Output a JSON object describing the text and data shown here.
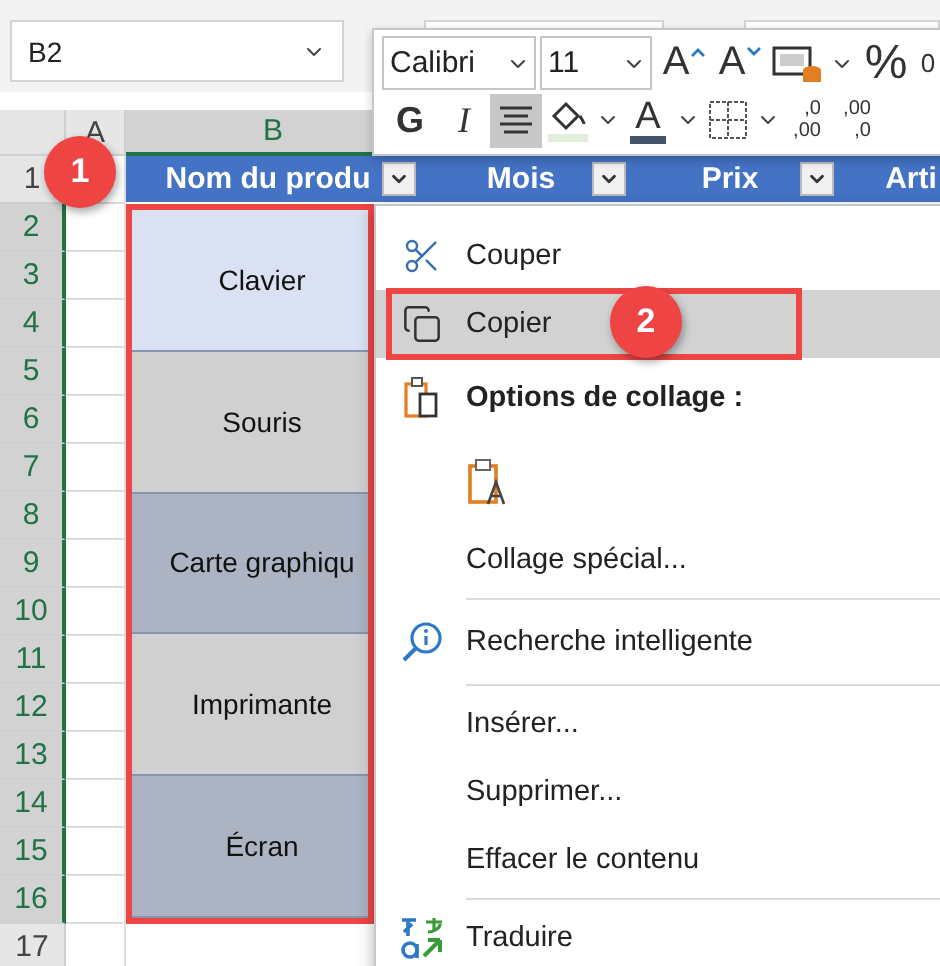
{
  "name_box": {
    "value": "B2"
  },
  "column_headers": [
    {
      "label": "A",
      "selected": false
    },
    {
      "label": "B",
      "selected": true
    }
  ],
  "row_headers": [
    {
      "label": "1",
      "selected": false
    },
    {
      "label": "2",
      "selected": true
    },
    {
      "label": "3",
      "selected": true
    },
    {
      "label": "4",
      "selected": true
    },
    {
      "label": "5",
      "selected": true
    },
    {
      "label": "6",
      "selected": true
    },
    {
      "label": "7",
      "selected": true
    },
    {
      "label": "8",
      "selected": true
    },
    {
      "label": "9",
      "selected": true
    },
    {
      "label": "10",
      "selected": true
    },
    {
      "label": "11",
      "selected": true
    },
    {
      "label": "12",
      "selected": true
    },
    {
      "label": "13",
      "selected": true
    },
    {
      "label": "14",
      "selected": true
    },
    {
      "label": "15",
      "selected": true
    },
    {
      "label": "16",
      "selected": true
    },
    {
      "label": "17",
      "selected": false
    }
  ],
  "table_header": [
    {
      "text": "Nom du produ",
      "filter": true
    },
    {
      "text": "Mois",
      "filter": true
    },
    {
      "text": "Prix",
      "filter": true
    },
    {
      "text": "Arti",
      "filter": false
    }
  ],
  "products": [
    {
      "text": "Clavier",
      "color": "#d9e1f2"
    },
    {
      "text": "Souris",
      "color": "#d0d0d0"
    },
    {
      "text": "Carte graphiqu",
      "color": "#acb4c4"
    },
    {
      "text": "Imprimante",
      "color": "#d0d0d0"
    },
    {
      "text": "Écran",
      "color": "#acb4c4"
    }
  ],
  "callouts": [
    "1",
    "2"
  ],
  "mini_toolbar": {
    "font": "Calibri",
    "size": "11",
    "row_1": [
      {
        "kind": "grow",
        "label": "A"
      },
      {
        "kind": "shrink",
        "label": "A"
      },
      {
        "kind": "format"
      },
      {
        "kind": "caret"
      },
      {
        "kind": "percent",
        "label": "%"
      },
      {
        "kind": "comma",
        "label": "0"
      }
    ],
    "row_2": [
      {
        "kind": "bold",
        "label": "G",
        "selected": false
      },
      {
        "kind": "italic",
        "label": "I",
        "selected": false
      },
      {
        "kind": "align",
        "selected": true
      },
      {
        "kind": "fill"
      },
      {
        "kind": "caret"
      },
      {
        "kind": "color",
        "label": "A"
      },
      {
        "kind": "caret"
      },
      {
        "kind": "borders"
      },
      {
        "kind": "caret"
      },
      {
        "kind": "decimal",
        "top": ",0",
        "bottom": ",00"
      },
      {
        "kind": "decimal",
        "top": ",00",
        "bottom": ",0"
      }
    ]
  },
  "context_menu": [
    {
      "kind": "cut",
      "label": "Couper",
      "selected": false,
      "annotated": false
    },
    {
      "kind": "copy",
      "label": "Copier",
      "selected": true,
      "annotated": true
    },
    {
      "kind": "heading",
      "label": "Options de collage :"
    },
    {
      "kind": "paste_options"
    },
    {
      "kind": "command",
      "label": "Collage spécial...",
      "selected": false,
      "annotated": false
    },
    {
      "kind": "separator"
    },
    {
      "kind": "lookup",
      "label": "Recherche intelligente",
      "selected": false,
      "annotated": false
    },
    {
      "kind": "separator"
    },
    {
      "kind": "command",
      "label": "Insérer...",
      "selected": false,
      "annotated": false
    },
    {
      "kind": "command",
      "label": "Supprimer...",
      "selected": false,
      "annotated": false
    },
    {
      "kind": "command",
      "label": "Effacer le contenu",
      "selected": false,
      "annotated": false
    },
    {
      "kind": "separator"
    },
    {
      "kind": "translate",
      "label": "Traduire",
      "selected": false,
      "annotated": false
    }
  ]
}
